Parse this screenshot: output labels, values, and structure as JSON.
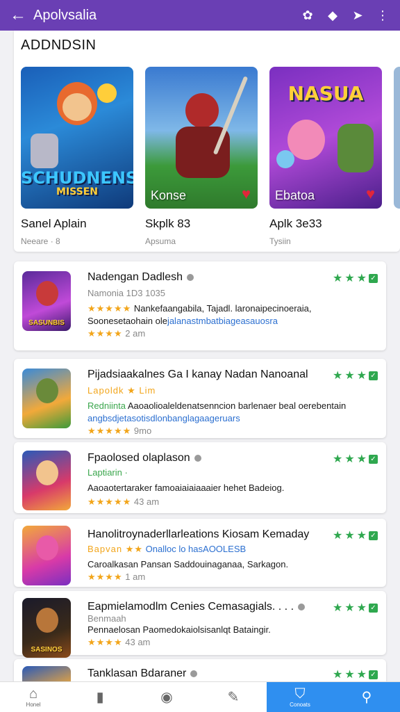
{
  "appbar": {
    "title": "Apolvsalia"
  },
  "featured": {
    "heading": "ADDNDSIN",
    "cards": [
      {
        "art_text": "SCHUDNENS",
        "art_sub": "MISSEN",
        "name": "Sanel Aplain",
        "meta": "Neeare · 8"
      },
      {
        "art_text": "",
        "caption": "Konse",
        "name": "Skplk 83",
        "meta": "Apsuma"
      },
      {
        "art_text": "NASUA",
        "caption": "Ebatoa",
        "name": "Aplk 3e33",
        "meta": "Tysiin"
      }
    ]
  },
  "list": [
    {
      "title": "Nadengan Dadlesh",
      "line1": "Namonia 1D3 1035",
      "line2_stars": "★★★★★",
      "line2": "Nankefaangabila, Tajadl. laronaipecinoeraia,",
      "line3a": "Soonesetaohain ole",
      "line3b": "jalanastmbatbiageasauosra",
      "line4_stars": "★★★★",
      "line4": "2 am",
      "thumb_text": "SASUNBIS"
    },
    {
      "title": "Pijadsiaakalnes Ga I kanay Nadan Nanoanal",
      "line1": "Lapoldk ★ Lim",
      "line2_green": "Redniinta",
      "line2": "Aaoaolioaleldenatsenncion barlenaer beal oerebentain",
      "line3": "angbsdjetasotisdlonbanglagaageruars",
      "line4_stars": "★★★★★",
      "line4": "9mo"
    },
    {
      "title": "Fpaolosed olaplason",
      "line1": "Laptiarin ·",
      "line2": "Aaoaotertaraker famoaiaiaiaaaier hehet Badeiog.",
      "line3_stars": "★★★★★",
      "line3": "43 am"
    },
    {
      "title": "Hanolitroynaderllarleations Kiosam Kemaday",
      "line1": "Bapvan ★★",
      "line1b": "Onalloc lo hasAOOLESB",
      "line2": "Caroalkasan Pansan Saddouinaganaa, Sarkagon.",
      "line3_stars": "★★★★",
      "line3": "1 am"
    },
    {
      "title": "Eapmielamodlm Cenies Cemasagials. . . .",
      "line1": "Benmaah",
      "line2": "Pennaelosan Paomedokaiolsisanlqt Bataingir.",
      "line3_stars": "★★★★",
      "line3": "43 am",
      "thumb_text": "SASINOS"
    },
    {
      "title": "Tanklasan Bdaraner"
    }
  ],
  "nav": [
    {
      "label": "Honel"
    },
    {
      "label": ""
    },
    {
      "label": ""
    },
    {
      "label": ""
    },
    {
      "label": "Conoats"
    },
    {
      "label": ""
    }
  ]
}
